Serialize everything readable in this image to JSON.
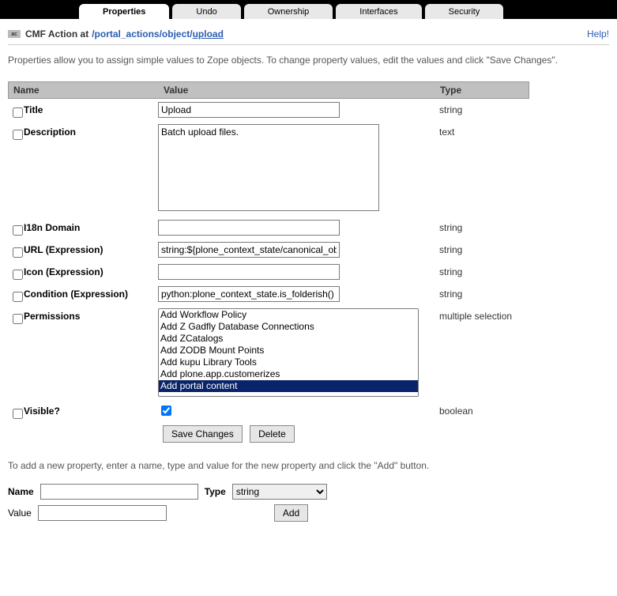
{
  "tabs": {
    "items": [
      {
        "label": "Properties",
        "active": true
      },
      {
        "label": "Undo",
        "active": false
      },
      {
        "label": "Ownership",
        "active": false
      },
      {
        "label": "Interfaces",
        "active": false
      },
      {
        "label": "Security",
        "active": false
      }
    ]
  },
  "header": {
    "icon_text": "ac",
    "title": "CMF Action at",
    "path_prefix": "/portal_actions/object/",
    "path_leaf": "upload",
    "help": "Help!"
  },
  "intro": "Properties allow you to assign simple values to Zope objects. To change property values, edit the values and click \"Save Changes\".",
  "columns": {
    "name": "Name",
    "value": "Value",
    "type": "Type"
  },
  "props": {
    "title": {
      "label": "Title",
      "value": "Upload",
      "type": "string"
    },
    "description": {
      "label": "Description",
      "value": "Batch upload files.",
      "type": "text"
    },
    "i18n_domain": {
      "label": "I18n Domain",
      "value": "",
      "type": "string"
    },
    "url_expr": {
      "label": "URL (Expression)",
      "value": "string:${plone_context_state/canonical_object_url}/@@upload",
      "type": "string"
    },
    "icon_expr": {
      "label": "Icon (Expression)",
      "value": "",
      "type": "string"
    },
    "condition_expr": {
      "label": "Condition (Expression)",
      "value": "python:plone_context_state.is_folderish()",
      "type": "string"
    },
    "permissions": {
      "label": "Permissions",
      "type": "multiple selection",
      "options": [
        "Add Workflow Policy",
        "Add Z Gadfly Database Connections",
        "Add ZCatalogs",
        "Add ZODB Mount Points",
        "Add kupu Library Tools",
        "Add plone.app.customerizes",
        "Add portal content"
      ],
      "selected": "Add portal content"
    },
    "visible": {
      "label": "Visible?",
      "checked": true,
      "type": "boolean"
    }
  },
  "buttons": {
    "save": "Save Changes",
    "delete": "Delete"
  },
  "add": {
    "intro": "To add a new property, enter a name, type and value for the new property and click the \"Add\" button.",
    "name_label": "Name",
    "type_label": "Type",
    "value_label": "Value",
    "type_selected": "string",
    "button": "Add"
  }
}
